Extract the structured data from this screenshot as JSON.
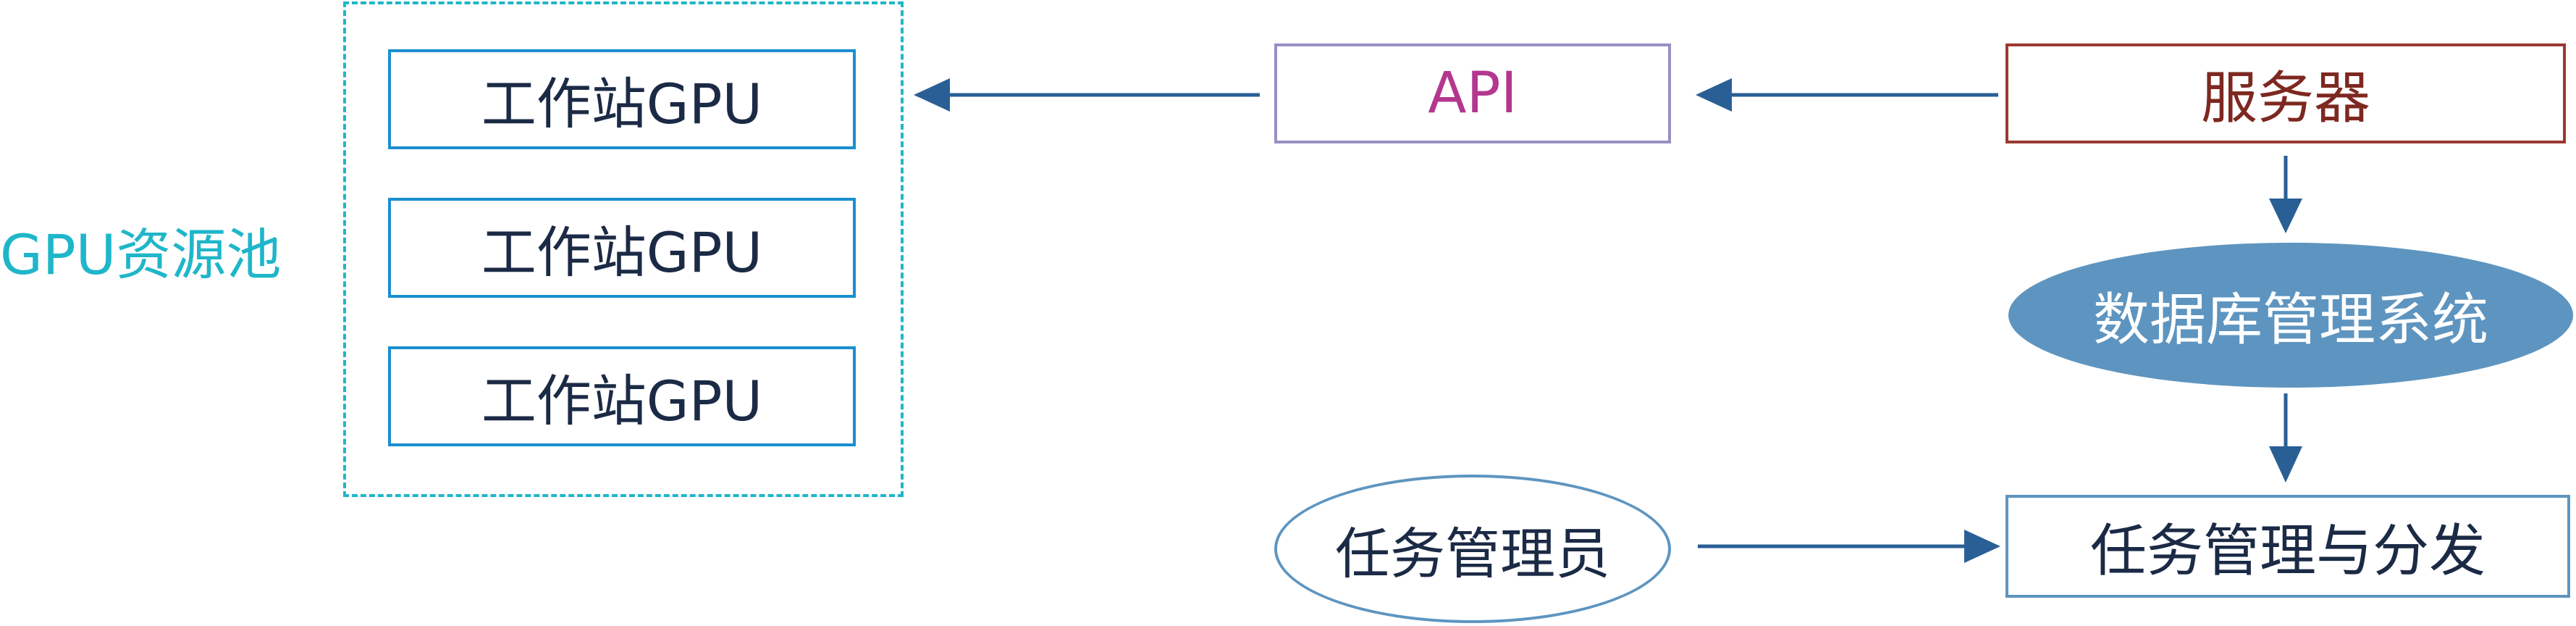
{
  "pool": {
    "label": "GPU资源池"
  },
  "workstations": [
    {
      "label": "工作站GPU"
    },
    {
      "label": "工作站GPU"
    },
    {
      "label": "工作站GPU"
    }
  ],
  "api": {
    "label": "API"
  },
  "server": {
    "label": "服务器"
  },
  "database": {
    "label": "数据库管理系统"
  },
  "admin": {
    "label": "任务管理员"
  },
  "task": {
    "label": "任务管理与分发"
  },
  "colors": {
    "pool": "#1fb6c9",
    "workstation_border": "#1a8fd0",
    "api_border": "#9a8fc4",
    "api_text": "#b4378f",
    "server_border": "#9b3a32",
    "server_text": "#7d2820",
    "db_fill": "#5e95c0",
    "arrow": "#2a5f96"
  }
}
